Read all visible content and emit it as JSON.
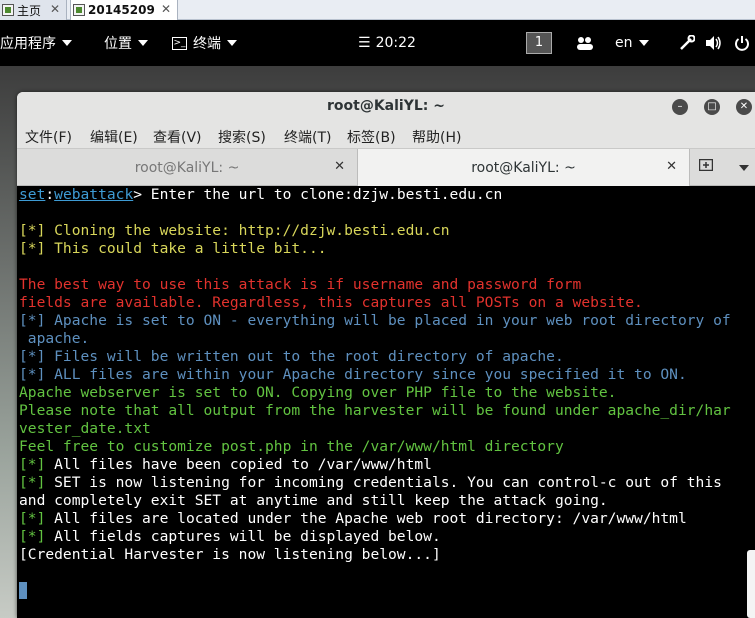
{
  "host_tabs": [
    {
      "label": "主页"
    },
    {
      "label": "20145209"
    }
  ],
  "topbar": {
    "apps": "应用程序",
    "places": "位置",
    "terminal": "终端",
    "clock_prefix": "☰",
    "clock": "20:22",
    "workspace": "1",
    "lang": "en"
  },
  "window": {
    "title": "root@KaliYL: ~"
  },
  "menu": [
    "文件(F)",
    "编辑(E)",
    "查看(V)",
    "搜索(S)",
    "终端(T)",
    "标签(B)",
    "帮助(H)"
  ],
  "tabs": [
    {
      "label": "root@KaliYL: ~"
    },
    {
      "label": "root@KaliYL: ~"
    }
  ],
  "terminal": {
    "prompt_set": "set",
    "prompt_sep": ":",
    "prompt_module": "webattack",
    "prompt_text": "> Enter the url to clone:dzjw.besti.edu.cn",
    "l_clone": "[*] Cloning the website: http://dzjw.besti.edu.cn",
    "l_wait": "[*] This could take a little bit...",
    "l_best1": "The best way to use this attack is if username and password form",
    "l_best2": "fields are available. Regardless, this captures all POSTs on a website.",
    "l_apache1": "[*] Apache is set to ON - everything will be placed in your web root directory of",
    "l_apache2": " apache.",
    "l_files": "[*] Files will be written out to the root directory of apache.",
    "l_all_files": "[*] ALL files are within your Apache directory since you specified it to ON.",
    "l_webserver": "Apache webserver is set to ON. Copying over PHP file to the website.",
    "l_note1": "Please note that all output from the harvester will be found under apache_dir/har",
    "l_note2": "vester_date.txt",
    "l_feel": "Feel free to customize post.php in the /var/www/html directory",
    "tag": "[*]",
    "l_copied": " All files have been copied to /var/www/html",
    "l_listen1": " SET is now listening for incoming credentials. You can control-c out of this",
    "l_listen2": "and completely exit SET at anytime and still keep the attack going.",
    "l_located": " All files are located under the Apache web root directory: /var/www/html",
    "l_captures": " All fields captures will be displayed below.",
    "l_harvester": "[Credential Harvester is now listening below...]"
  },
  "colors": {
    "cyan": "#3e9bd4",
    "yellow": "#d8d65a",
    "red": "#e2322d",
    "blue": "#5e90bf",
    "green": "#62c341"
  }
}
